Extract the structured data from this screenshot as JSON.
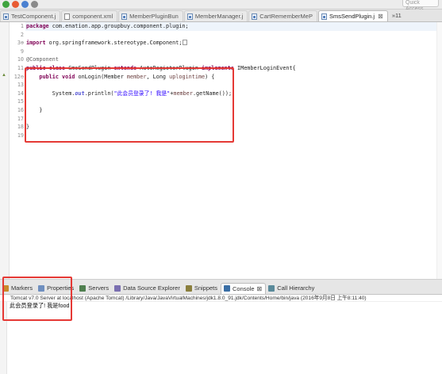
{
  "toolbar": {
    "icon_colors": [
      "#3fa33f",
      "#e85b33",
      "#4a80d0",
      "#8a8a8a"
    ],
    "quick_access_placeholder": "Quick Access"
  },
  "editor_tabs": [
    {
      "label": "TestComponent.j",
      "icon": "java-file-icon",
      "active": false
    },
    {
      "label": "component.xml",
      "icon": "xml-file-icon",
      "active": false
    },
    {
      "label": "MemberPluginBun",
      "icon": "java-file-icon",
      "active": false
    },
    {
      "label": "MemberManager.j",
      "icon": "java-file-icon",
      "active": false
    },
    {
      "label": "CartRememberMeP",
      "icon": "java-file-icon",
      "active": false
    },
    {
      "label": "SmsSendPlugin.j",
      "icon": "java-file-icon",
      "active": true
    }
  ],
  "editor_tabs_close": "⊠",
  "editor_tabs_overflow": "»11",
  "code": {
    "line_numbers": [
      "1",
      "2",
      "3⊕",
      "9",
      "10",
      "11",
      "12⊖",
      "13",
      "14",
      "15",
      "16",
      "17",
      "18",
      "19"
    ],
    "lines": {
      "l1": {
        "kw": "package",
        "rest": " com.enation.app.groupbuy.component.plugin;"
      },
      "l3": {
        "kw": "import",
        "rest": " org.springframework.stereotype.Component;"
      },
      "l10": {
        "annotation": "@Component"
      },
      "l11": {
        "kw1": "public",
        "kw2": "class",
        "name": " SmsSendPlugin ",
        "kw3": "extends",
        "mid": " AutoRegisterPlugin ",
        "kw4": "implements",
        "rest": " IMemberLoginEvent{"
      },
      "l13": {
        "kw1": "public",
        "kw2": "void",
        "sig1": " onLogin(Member ",
        "p1": "member",
        "sig2": ", Long ",
        "p2": "uplogintime",
        "sig3": ") {"
      },
      "l15": {
        "pre": "System.",
        "field": "out",
        "mid": ".println(",
        "str": "\"此会员登录了! 我是\"",
        "plus": "+",
        "p": "member",
        "tail": ".getName());"
      },
      "l17": {
        "text": "}"
      },
      "l19": {
        "text": "}"
      }
    }
  },
  "views": [
    {
      "label": "Markers",
      "icon": "markers-icon",
      "color": "#c98a2b",
      "active": false
    },
    {
      "label": "Properties",
      "icon": "properties-icon",
      "color": "#6f8fbf",
      "active": false
    },
    {
      "label": "Servers",
      "icon": "servers-icon",
      "color": "#4f7f4f",
      "active": false
    },
    {
      "label": "Data Source Explorer",
      "icon": "database-icon",
      "color": "#7a6fb0",
      "active": false
    },
    {
      "label": "Snippets",
      "icon": "snippets-icon",
      "color": "#8a7f3d",
      "active": false
    },
    {
      "label": "Console",
      "icon": "console-icon",
      "color": "#3a6ea5",
      "active": true
    },
    {
      "label": "Call Hierarchy",
      "icon": "call-hierarchy-icon",
      "color": "#5a8a9a",
      "active": false
    }
  ],
  "console_close": "⊠",
  "console": {
    "header": "Tomcat v7.0 Server at localhost (Apache Tomcat) /Library/Java/JavaVirtualMachines/jdk1.8.0_91.jdk/Contents/Home/bin/java (2016年9月8日 上午8:11:40)",
    "output": "此会员登录了! 我是food"
  }
}
